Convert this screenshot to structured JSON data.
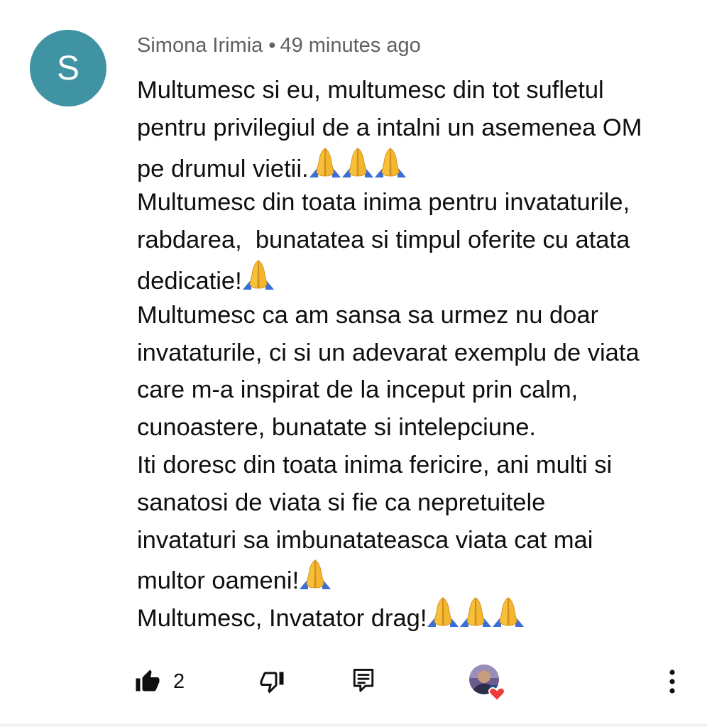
{
  "comment": {
    "avatar_initial": "S",
    "avatar_color": "#3f93a2",
    "author": "Simona Irimia",
    "separator": "•",
    "timestamp": "49 minutes ago",
    "lines": [
      "Multumesc si eu, multumesc din tot sufletul",
      "pentru privilegiul de a intalni un asemenea OM",
      "pe drumul vietii.",
      "Multumesc din toata inima pentru invataturile,",
      "rabdarea,  bunatatea si timpul oferite cu atata",
      "dedicatie!",
      "Multumesc ca am sansa sa urmez nu doar",
      "invataturile, ci si un adevarat exemplu de viata",
      "care m-a inspirat de la inceput prin calm,",
      "cunoastere, bunatate si intelepciune.",
      "Iti doresc din toata inima fericire, ani multi si",
      "sanatosi de viata si fie ca nepretuitele",
      "invataturi sa imbunatateasca viata cat mai",
      "multor oameni!",
      "Multumesc, Invatator drag!"
    ],
    "emoji": "folded-hands-emoji"
  },
  "actions": {
    "like_icon": "thumbs-up-icon",
    "like_count": "2",
    "dislike_icon": "thumbs-down-icon",
    "reply_icon": "reply-comment-icon",
    "creator_heart": "creator-heart-avatar",
    "more_icon": "more-vertical-icon"
  }
}
